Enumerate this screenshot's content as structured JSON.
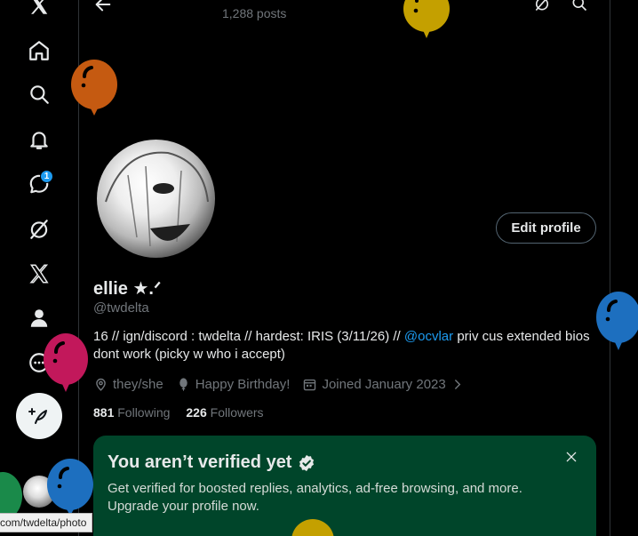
{
  "header": {
    "post_count": "1,288 posts"
  },
  "nav": {
    "messages_badge": "1",
    "items": [
      "x-logo-icon",
      "home-icon",
      "search-icon",
      "notifications-icon",
      "messages-icon",
      "grok-icon",
      "premium-x-icon",
      "profile-icon",
      "more-icon"
    ]
  },
  "profile": {
    "display_name": "ellie ★.ᐟ",
    "handle": "@twdelta",
    "edit_button": "Edit profile",
    "bio_text": "16 // ign/discord : twdelta // hardest: IRIS (3/11/26) // ",
    "bio_mention": "@ocvlar",
    "bio_after": " priv cus extended bios dont work (picky w who i accept)",
    "pronouns": "they/she",
    "birthday": "Happy Birthday!",
    "joined": "Joined January 2023",
    "following_count": "881",
    "following_label": " Following",
    "followers_count": "226",
    "followers_label": " Followers"
  },
  "verify_card": {
    "title": "You aren’t verified yet",
    "body": "Get verified for boosted replies, analytics, ad-free browsing, and more. Upgrade your profile now."
  },
  "status_bar": {
    "url": "com/twdelta/photo"
  },
  "colors": {
    "background": "#000000",
    "accent": "#1d9bf0",
    "verify_card": "#00452a",
    "balloon_orange": "#c55a11",
    "balloon_gold": "#c4a000",
    "balloon_blue": "#1d6fbf",
    "balloon_pink": "#c2185b",
    "balloon_green": "#1a8a4a"
  }
}
